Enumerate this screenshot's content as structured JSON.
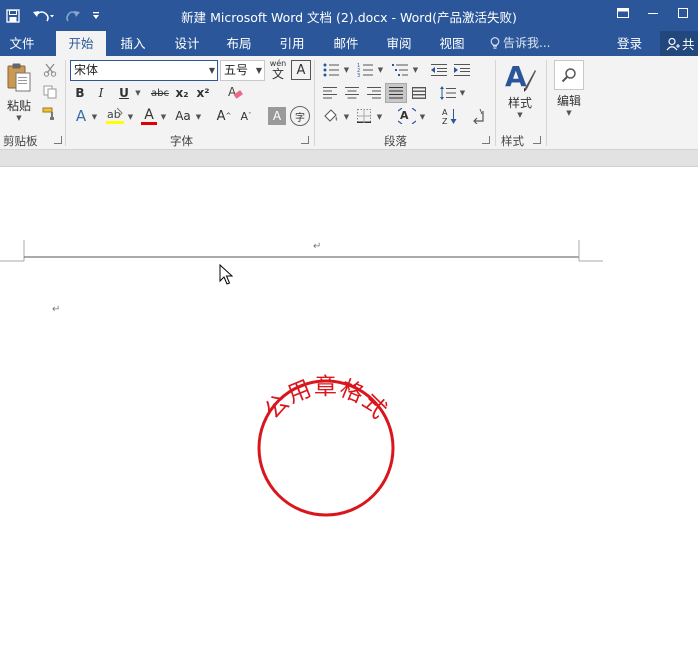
{
  "window": {
    "title": "新建 Microsoft Word 文档 (2).docx - Word(产品激活失败)",
    "save_icon": "save-icon",
    "undo_icon": "undo-icon",
    "redo_icon": "redo-icon",
    "customize_icon": "customize-qat-icon"
  },
  "tabs": {
    "file": "文件",
    "home": "开始",
    "insert": "插入",
    "design": "设计",
    "layout": "布局",
    "references": "引用",
    "mailings": "邮件",
    "review": "审阅",
    "view": "视图",
    "tell_me": "告诉我...",
    "login": "登录",
    "share": "共"
  },
  "ribbon": {
    "clipboard": {
      "label": "剪贴板",
      "paste_label": "粘贴"
    },
    "font": {
      "label": "字体",
      "font_name": "宋体",
      "font_size": "五号",
      "bold": "B",
      "italic": "I",
      "underline": "U",
      "strike": "abc",
      "subscript": "x₂",
      "superscript": "x²",
      "text_effects": "A",
      "font_color": "A",
      "change_case": "Aa",
      "grow": "A",
      "shrink": "A",
      "char_shading": "A",
      "enclose": "字",
      "phonetic": "wén",
      "char_border": "A"
    },
    "paragraph": {
      "label": "段落"
    },
    "styles": {
      "label": "样式",
      "styles_button": "样式"
    },
    "editing": {
      "editing_button": "编辑"
    }
  },
  "document": {
    "header_mark": "↵",
    "para_mark": "↵",
    "seal_text": "公用章格式"
  },
  "colors": {
    "brand": "#2b579a",
    "seal_red": "#d9161c",
    "font_color_bar": "#e00000",
    "highlight_bar": "#ffff00"
  }
}
